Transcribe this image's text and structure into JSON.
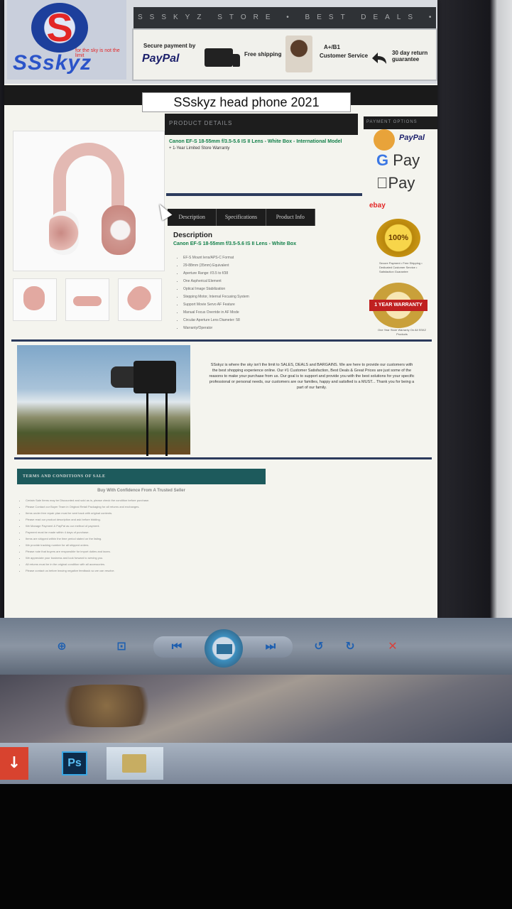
{
  "header": {
    "logo_text": "SSskyz",
    "logo_sub": "for the sky is not the limit",
    "top_banner": "SSSKYZ STORE • BEST DEALS • BARGAINS",
    "trust": {
      "secure_label": "Secure payment by",
      "paypal": "PayPal",
      "shipping": "Free shipping",
      "service_label": "A+/B1",
      "service": "Customer Service",
      "returns": "30 day return guarantee"
    }
  },
  "product": {
    "title": "SSskyz head phone 2021",
    "info_header": "PRODUCT DETAILS",
    "name": "Canon EF-S 18-55mm f/3.5-5.6 IS II Lens - White Box - International Model",
    "subtitle": "+ 1-Year Limited Store Warranty",
    "tabs": [
      "Description",
      "Specifications",
      "Product Info"
    ],
    "description_heading": "Description",
    "description_sub": "Canon EF-S 18-55mm f/3.5-5.6 IS II Lens - White Box",
    "features": [
      "EF-S Mount lens/APS-C Format",
      "29-88mm (35mm) Equivalent",
      "Aperture Range: f/3.5 to f/38",
      "One Aspherical Element",
      "Optical Image Stabilization",
      "Stepping Motor, Internal Focusing System",
      "Support Movie Servo AF Feature",
      "Manual Focus Override in AF Mode",
      "Circular Aperture Lens Diameter: 58",
      "Warranty/Operator"
    ]
  },
  "right_column": {
    "header": "PAYMENT OPTIONS",
    "paypal": "PayPal",
    "gpay_g": "G",
    "gpay": "Pay",
    "apple_pay": "Pay",
    "ebay": "ebay",
    "guarantee": "100%",
    "guarantee_note": "Secure Payment • Free Shipping • Dedicated Customer Service • Satisfaction Guarantee",
    "warranty": "1 YEAR WARRANTY",
    "warranty_note": "One Year Store Warranty On All SSKZ Products"
  },
  "about": {
    "text": "SSskyz is where the sky isn't the limit to SALES, DEALS and BARGAINS. We are here to provide our customers with the best shopping experience online. Our #1 Customer Satisfaction, Best Deals & Great Prices are just some of the reasons to make your purchase from us. Our goal is to support and provide you with the best solutions for your specific professional or personal needs, our customers are our families, happy and satisfied is a MUST... Thank you for being a part of our family."
  },
  "terms": {
    "header": "TERMS AND CONDITIONS OF SALE",
    "title": "Buy With Confidence From A Trusted Seller",
    "lines": [
      "Certain Sale Items may be Discounted and sold as is, please check the condition before purchase.",
      "Please Contact our Buyer Team in Original Retail Packaging for all returns and exchanges.",
      "Items under free repair plan must be sent back with original contents.",
      "Please read our product description and ask before bidding.",
      "We Manage Payment & PayPal as our method of payment.",
      "Payment must be made within 4 days of purchase.",
      "Items are shipped within the time period stated on the listing.",
      "We provide tracking number for all shipped orders.",
      "Please note that buyers are responsible for import duties and taxes.",
      "We appreciate your business and look forward to serving you.",
      "All returns must be in the original condition with all accessories.",
      "Please contact us before leaving negative feedback so we can resolve."
    ]
  },
  "viewer": {
    "zoom": "⊕",
    "fit": "⊡",
    "prev": "⏮",
    "next": "⏭",
    "rotate_ccw": "↺",
    "rotate_cw": "↻",
    "delete": "✕"
  },
  "taskbar": {
    "download": "↓",
    "photoshop": "Ps"
  },
  "colors": {
    "accent_green": "#13804a",
    "header_dark": "#1d1d1d",
    "terms_teal": "#1d5a5c",
    "brand_red": "#e32626",
    "brand_blue": "#2b54c9"
  }
}
